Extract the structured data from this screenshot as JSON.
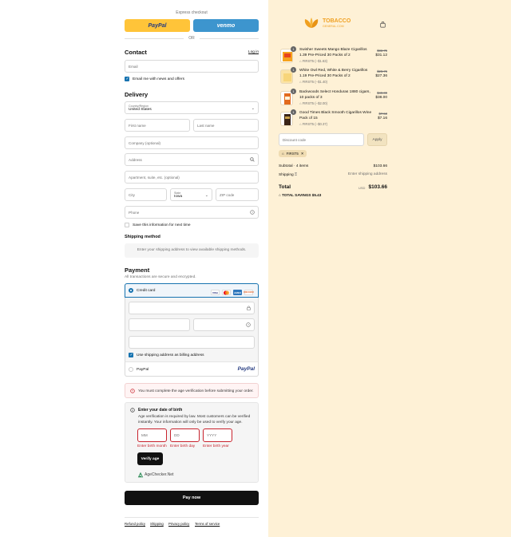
{
  "express": {
    "title": "Express checkout",
    "paypal_label": "PayPal",
    "venmo_label": "venmo",
    "or_label": "OR"
  },
  "contact": {
    "heading": "Contact",
    "login_link": "Log in",
    "email_placeholder": "Email",
    "email_news_label": "Email me with news and offers",
    "email_news_checked": true
  },
  "delivery": {
    "heading": "Delivery",
    "country_label": "Country/Region",
    "country_value": "United States",
    "first_name_placeholder": "First name",
    "last_name_placeholder": "Last name",
    "company_placeholder": "Company (optional)",
    "address_placeholder": "Address",
    "apartment_placeholder": "Apartment, suite, etc. (optional)",
    "city_placeholder": "City",
    "state_label": "State",
    "state_value": "Iowa",
    "zip_placeholder": "ZIP code",
    "phone_placeholder": "Phone",
    "save_info_label": "Save this information for next time"
  },
  "shipping": {
    "heading": "Shipping method",
    "message": "Enter your shipping address to view available shipping methods."
  },
  "payment": {
    "heading": "Payment",
    "subtitle": "All transactions are secure and encrypted.",
    "credit_card_label": "Credit card",
    "card_brands": [
      "VISA",
      "MC",
      "AMEX",
      "DISCOVER"
    ],
    "billing_same_label": "Use shipping address as billing address",
    "paypal_option_label": "PayPal",
    "paypal_logo_text": "PayPal"
  },
  "age_error": {
    "message": "You must complete the age verification before submitting your order."
  },
  "dob": {
    "heading": "Enter your date of birth",
    "description": [
      "Age verification is required by law. Most customers can be verified",
      "instantly. Your information will only be used to verify your age."
    ],
    "month_placeholder": "MM",
    "day_placeholder": "DD",
    "year_placeholder": "YYYY",
    "month_error": "Enter birth month",
    "day_error": "Enter birth day",
    "year_error": "Enter birth year",
    "verify_button": "Verify age",
    "agechecker_brand": "AgeChecker.Net"
  },
  "pay_now": "Pay now",
  "footer_links": [
    "Refund policy",
    "Shipping",
    "Privacy policy",
    "Terms of service"
  ],
  "brand": {
    "line1": "TOBACCO",
    "line2": "GENERAL.COM"
  },
  "cart": {
    "items": [
      {
        "qty": "1",
        "name": [
          "Swisher Sweets Mango Blaze Cigarillos",
          "1.39 Pre-Priced 30 Packs of 2"
        ],
        "discount": "FIRST5 (−$1.63)",
        "orig_price": "$32.75",
        "price": "$31.12"
      },
      {
        "qty": "1",
        "name": [
          "White Owl Red, White & Berry Cigarillos",
          "1.19 Pre-Priced 30 Packs of 2"
        ],
        "discount": "FIRST5 (−$1.40)",
        "orig_price": "$28.76",
        "price": "$27.36"
      },
      {
        "qty": "1",
        "name": [
          "Backwoods Select Honduras 1880 cigars,",
          "10 packs of 3"
        ],
        "discount": "FIRST5 (−$2.00)",
        "orig_price": "$40.00",
        "price": "$38.00"
      },
      {
        "qty": "1",
        "name": [
          "Good Times Black Smooth Cigarillos Wine",
          "Pack of 15"
        ],
        "discount": "FIRST5 (−$0.37)",
        "orig_price": "$7.53",
        "price": "$7.16"
      }
    ],
    "discount_placeholder": "Discount code",
    "apply_label": "Apply",
    "applied_code": "FIRST5",
    "subtotal_label": "Subtotal · 4 items",
    "subtotal_value": "$103.66",
    "shipping_label": "Shipping",
    "shipping_value": "Enter shipping address",
    "total_label": "Total",
    "currency": "USD",
    "total_value": "$103.66",
    "savings_label": "TOTAL SAVINGS",
    "savings_value": "$5.43"
  },
  "colors": {
    "accent": "#1773b0",
    "error": "#c8232d",
    "sidebar_bg": "#fef1d6",
    "brand_orange": "#f0a020"
  }
}
